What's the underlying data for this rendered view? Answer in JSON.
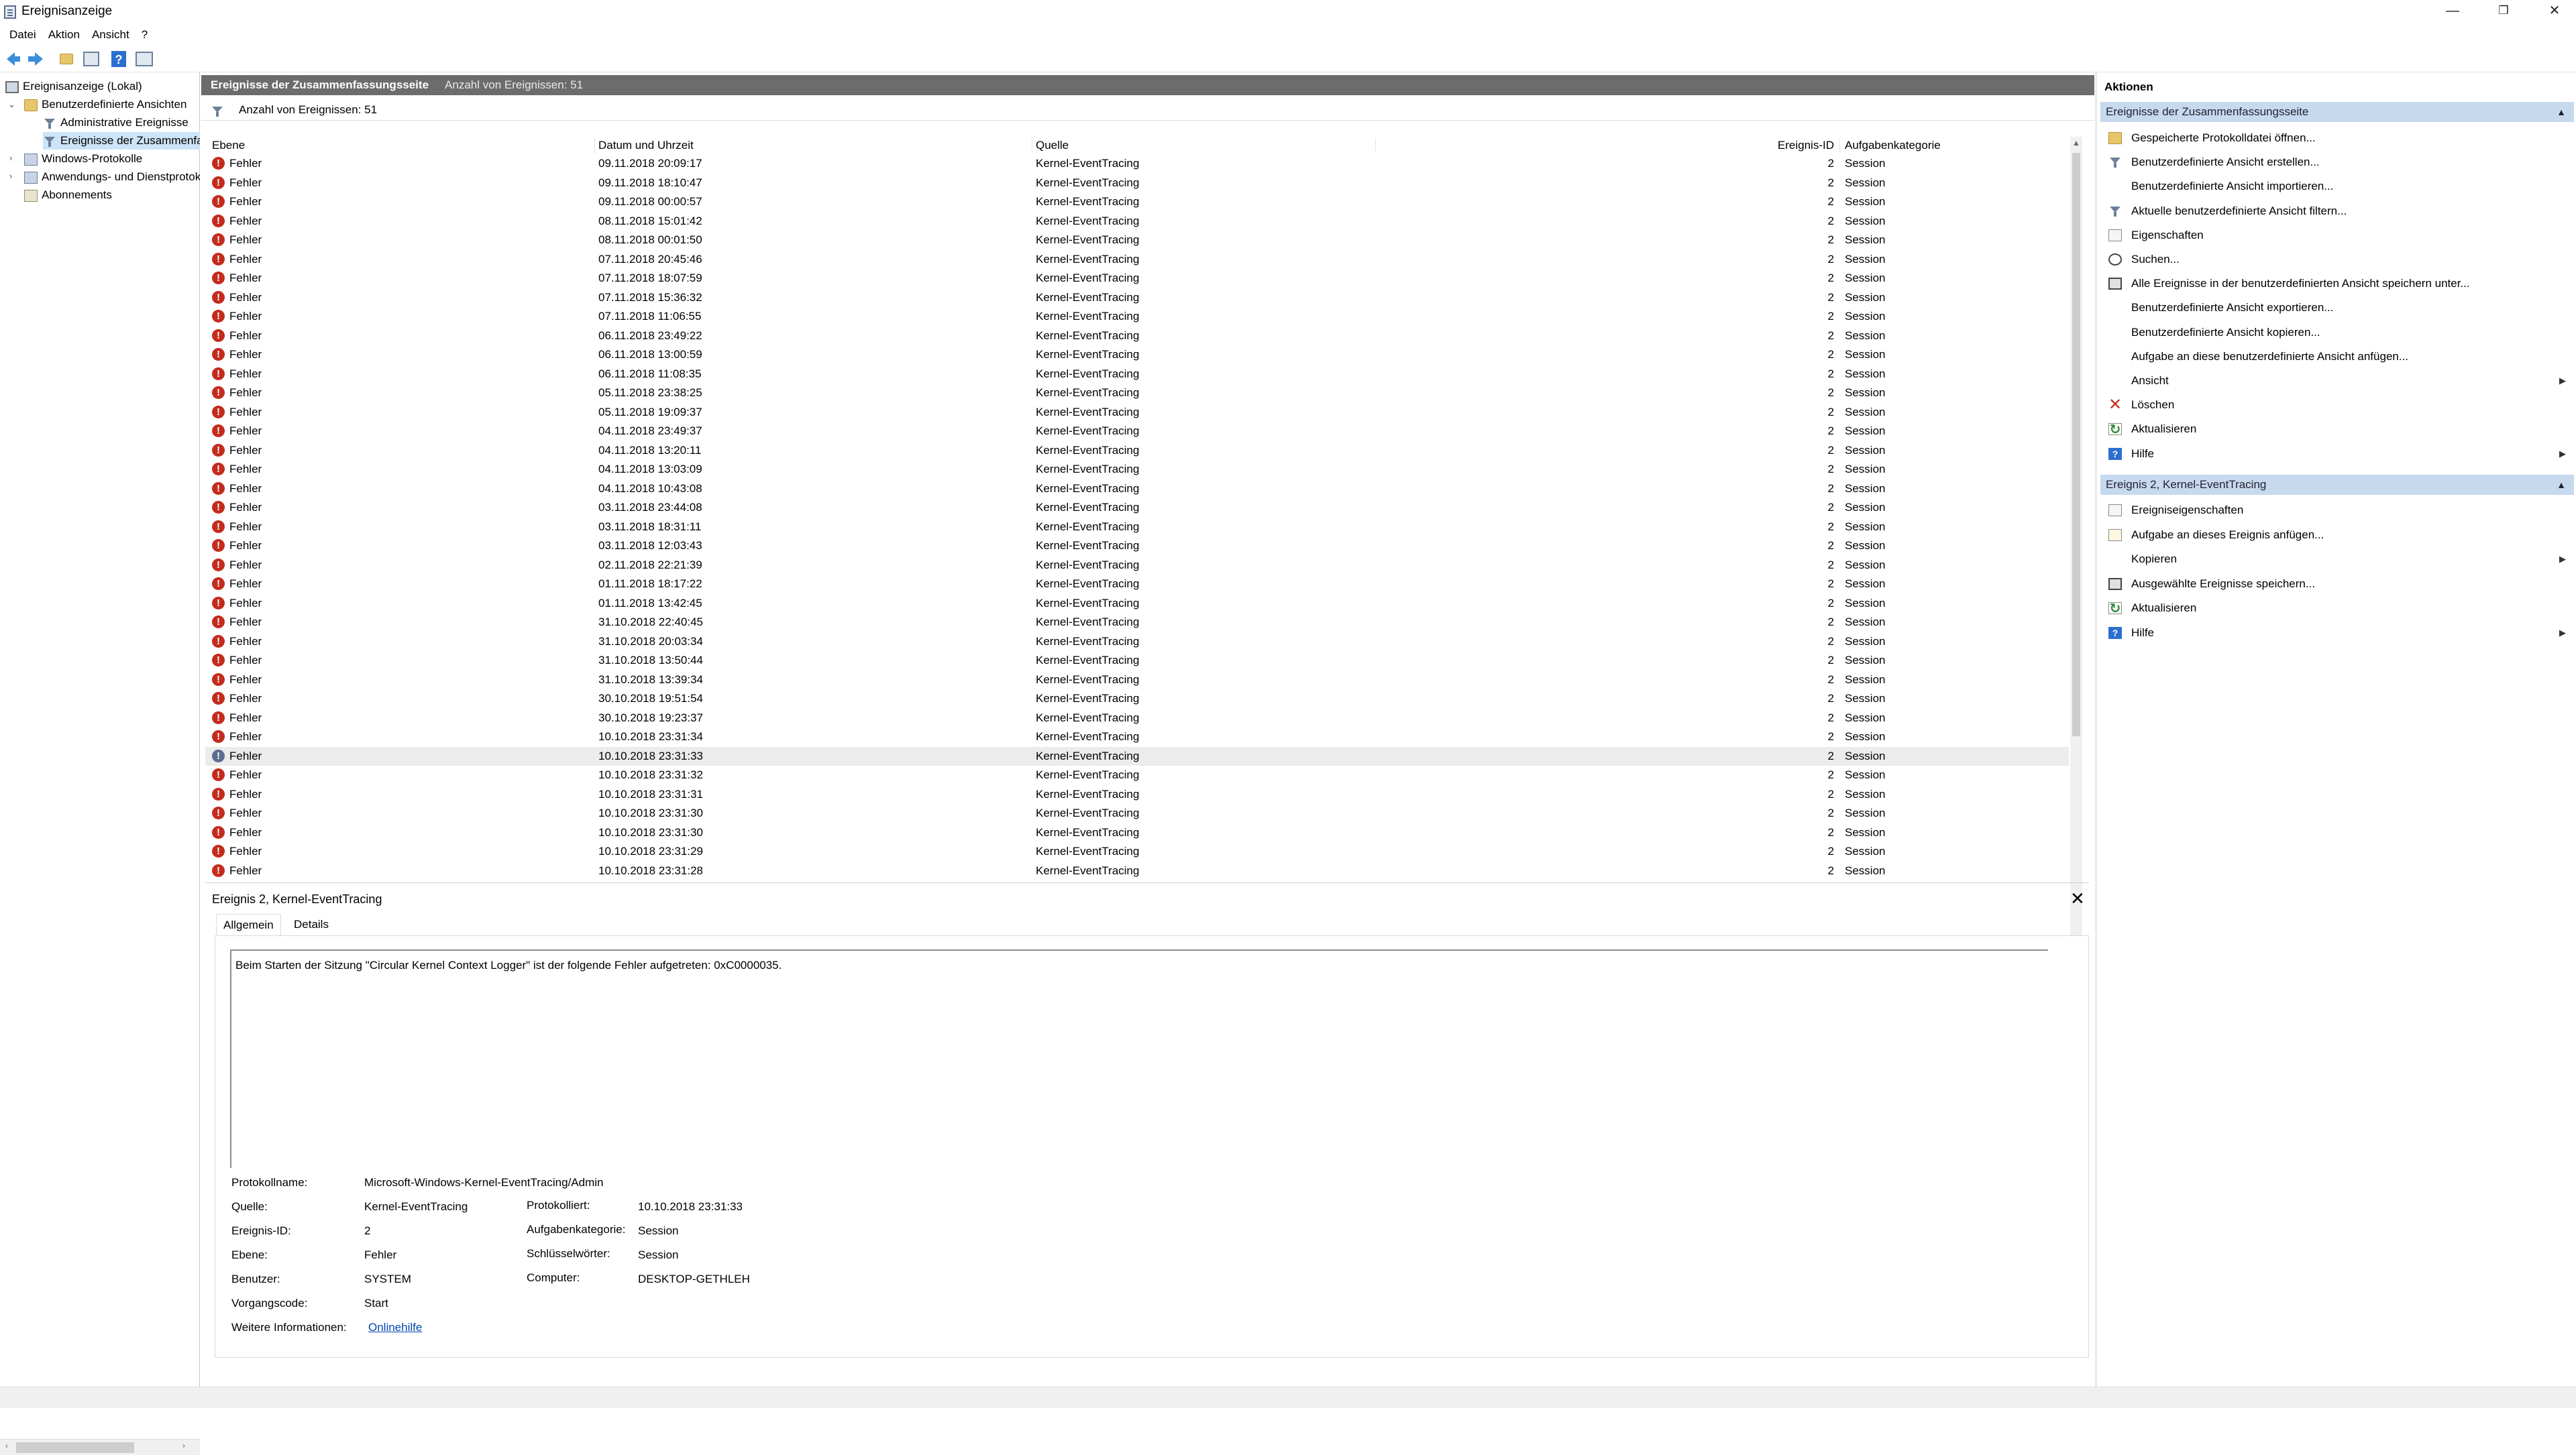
{
  "window": {
    "title": "Ereignisanzeige",
    "minimize": "—",
    "maximize": "❐",
    "close": "✕"
  },
  "menu": [
    "Datei",
    "Aktion",
    "Ansicht",
    "?"
  ],
  "toolbar": {
    "icons": [
      "back-arrow-icon",
      "forward-arrow-icon",
      "folder-up-icon",
      "console-tree-icon",
      "help-icon",
      "action-pane-icon"
    ],
    "help_glyph": "?"
  },
  "tree": {
    "root": "Ereignisanzeige (Lokal)",
    "custom_views": "Benutzerdefinierte Ansichten",
    "admin_events": "Administrative Ereignisse",
    "summary_events": "Ereignisse der Zusammenfassungsseite",
    "windows_logs": "Windows-Protokolle",
    "app_service_logs": "Anwendungs- und Dienstprotokolle",
    "subscriptions": "Abonnements"
  },
  "summary": {
    "title": "Ereignisse der Zusammenfassungsseite",
    "count_label": "Anzahl von Ereignissen: 51",
    "filter_count": "Anzahl von Ereignissen: 51"
  },
  "table": {
    "columns": [
      "Ebene",
      "Datum und Uhrzeit",
      "Quelle",
      "Ereignis-ID",
      "Aufgabenkategorie"
    ],
    "level": "Fehler",
    "source": "Kernel-EventTracing",
    "event_id": "2",
    "category": "Session",
    "timestamps": [
      "09.11.2018 20:09:17",
      "09.11.2018 18:10:47",
      "09.11.2018 00:00:57",
      "08.11.2018 15:01:42",
      "08.11.2018 00:01:50",
      "07.11.2018 20:45:46",
      "07.11.2018 18:07:59",
      "07.11.2018 15:36:32",
      "07.11.2018 11:06:55",
      "06.11.2018 23:49:22",
      "06.11.2018 13:00:59",
      "06.11.2018 11:08:35",
      "05.11.2018 23:38:25",
      "05.11.2018 19:09:37",
      "04.11.2018 23:49:37",
      "04.11.2018 13:20:11",
      "04.11.2018 13:03:09",
      "04.11.2018 10:43:08",
      "03.11.2018 23:44:08",
      "03.11.2018 18:31:11",
      "03.11.2018 12:03:43",
      "02.11.2018 22:21:39",
      "01.11.2018 18:17:22",
      "01.11.2018 13:42:45",
      "31.10.2018 22:40:45",
      "31.10.2018 20:03:34",
      "31.10.2018 13:50:44",
      "31.10.2018 13:39:34",
      "30.10.2018 19:51:54",
      "30.10.2018 19:23:37",
      "10.10.2018 23:31:34",
      "10.10.2018 23:31:33",
      "10.10.2018 23:31:32",
      "10.10.2018 23:31:31",
      "10.10.2018 23:31:30",
      "10.10.2018 23:31:30",
      "10.10.2018 23:31:29",
      "10.10.2018 23:31:28"
    ],
    "selected_index": 31
  },
  "detail": {
    "title": "Ereignis 2, Kernel-EventTracing",
    "close": "✕",
    "tab_general": "Allgemein",
    "tab_details": "Details",
    "message": "Beim Starten der Sitzung \"Circular Kernel Context Logger\" ist der folgende Fehler aufgetreten: 0xC0000035.",
    "labels": {
      "log_name": "Protokollname:",
      "source": "Quelle:",
      "event_id": "Ereignis-ID:",
      "level": "Ebene:",
      "user": "Benutzer:",
      "opcode": "Vorgangscode:",
      "more_info": "Weitere Informationen:",
      "logged": "Protokolliert:",
      "task_category": "Aufgabenkategorie:",
      "keywords": "Schlüsselwörter:",
      "computer": "Computer:"
    },
    "values": {
      "log_name": "Microsoft-Windows-Kernel-EventTracing/Admin",
      "source": "Kernel-EventTracing",
      "event_id": "2",
      "level": "Fehler",
      "user": "SYSTEM",
      "opcode": "Start",
      "more_info": "Onlinehilfe",
      "logged": "10.10.2018 23:31:33",
      "task_category": "Session",
      "keywords": "Session",
      "computer": "DESKTOP-GETHLEH"
    }
  },
  "actions": {
    "title": "Aktionen",
    "section1": "Ereignisse der Zusammenfassungsseite",
    "items1": [
      {
        "label": "Gespeicherte Protokolldatei öffnen...",
        "icon": "open-log-icon"
      },
      {
        "label": "Benutzerdefinierte Ansicht erstellen...",
        "icon": "create-view-icon"
      },
      {
        "label": "Benutzerdefinierte Ansicht importieren...",
        "icon": ""
      },
      {
        "label": "Aktuelle benutzerdefinierte Ansicht filtern...",
        "icon": "filter-icon"
      },
      {
        "label": "Eigenschaften",
        "icon": "properties-icon"
      },
      {
        "label": "Suchen...",
        "icon": "find-icon"
      },
      {
        "label": "Alle Ereignisse in der benutzerdefinierten Ansicht speichern unter...",
        "icon": "save-icon"
      },
      {
        "label": "Benutzerdefinierte Ansicht exportieren...",
        "icon": ""
      },
      {
        "label": "Benutzerdefinierte Ansicht kopieren...",
        "icon": ""
      },
      {
        "label": "Aufgabe an diese benutzerdefinierte Ansicht anfügen...",
        "icon": ""
      },
      {
        "label": "Ansicht",
        "icon": "",
        "submenu": true
      },
      {
        "label": "Löschen",
        "icon": "delete-icon"
      },
      {
        "label": "Aktualisieren",
        "icon": "refresh-icon"
      },
      {
        "label": "Hilfe",
        "icon": "help-icon",
        "submenu": true
      }
    ],
    "section2": "Ereignis 2, Kernel-EventTracing",
    "items2": [
      {
        "label": "Ereigniseigenschaften",
        "icon": "event-properties-icon"
      },
      {
        "label": "Aufgabe an dieses Ereignis anfügen...",
        "icon": "attach-task-icon"
      },
      {
        "label": "Kopieren",
        "icon": "",
        "submenu": true
      },
      {
        "label": "Ausgewählte Ereignisse speichern...",
        "icon": "save-icon"
      },
      {
        "label": "Aktualisieren",
        "icon": "refresh-icon"
      },
      {
        "label": "Hilfe",
        "icon": "help-icon",
        "submenu": true
      }
    ],
    "caret": "▲",
    "submenu_arrow": "▶"
  }
}
